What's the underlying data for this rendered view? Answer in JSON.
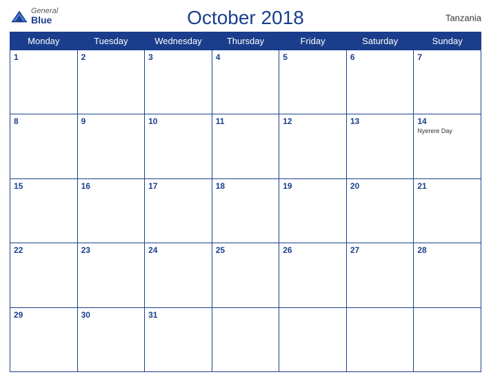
{
  "header": {
    "logo": {
      "general": "General",
      "blue": "Blue",
      "icon_color": "#1a3e8c"
    },
    "title": "October 2018",
    "country": "Tanzania"
  },
  "weekdays": [
    "Monday",
    "Tuesday",
    "Wednesday",
    "Thursday",
    "Friday",
    "Saturday",
    "Sunday"
  ],
  "weeks": [
    [
      {
        "day": 1,
        "event": ""
      },
      {
        "day": 2,
        "event": ""
      },
      {
        "day": 3,
        "event": ""
      },
      {
        "day": 4,
        "event": ""
      },
      {
        "day": 5,
        "event": ""
      },
      {
        "day": 6,
        "event": ""
      },
      {
        "day": 7,
        "event": ""
      }
    ],
    [
      {
        "day": 8,
        "event": ""
      },
      {
        "day": 9,
        "event": ""
      },
      {
        "day": 10,
        "event": ""
      },
      {
        "day": 11,
        "event": ""
      },
      {
        "day": 12,
        "event": ""
      },
      {
        "day": 13,
        "event": ""
      },
      {
        "day": 14,
        "event": "Nyerere Day"
      }
    ],
    [
      {
        "day": 15,
        "event": ""
      },
      {
        "day": 16,
        "event": ""
      },
      {
        "day": 17,
        "event": ""
      },
      {
        "day": 18,
        "event": ""
      },
      {
        "day": 19,
        "event": ""
      },
      {
        "day": 20,
        "event": ""
      },
      {
        "day": 21,
        "event": ""
      }
    ],
    [
      {
        "day": 22,
        "event": ""
      },
      {
        "day": 23,
        "event": ""
      },
      {
        "day": 24,
        "event": ""
      },
      {
        "day": 25,
        "event": ""
      },
      {
        "day": 26,
        "event": ""
      },
      {
        "day": 27,
        "event": ""
      },
      {
        "day": 28,
        "event": ""
      }
    ],
    [
      {
        "day": 29,
        "event": ""
      },
      {
        "day": 30,
        "event": ""
      },
      {
        "day": 31,
        "event": ""
      },
      {
        "day": null,
        "event": ""
      },
      {
        "day": null,
        "event": ""
      },
      {
        "day": null,
        "event": ""
      },
      {
        "day": null,
        "event": ""
      }
    ]
  ]
}
